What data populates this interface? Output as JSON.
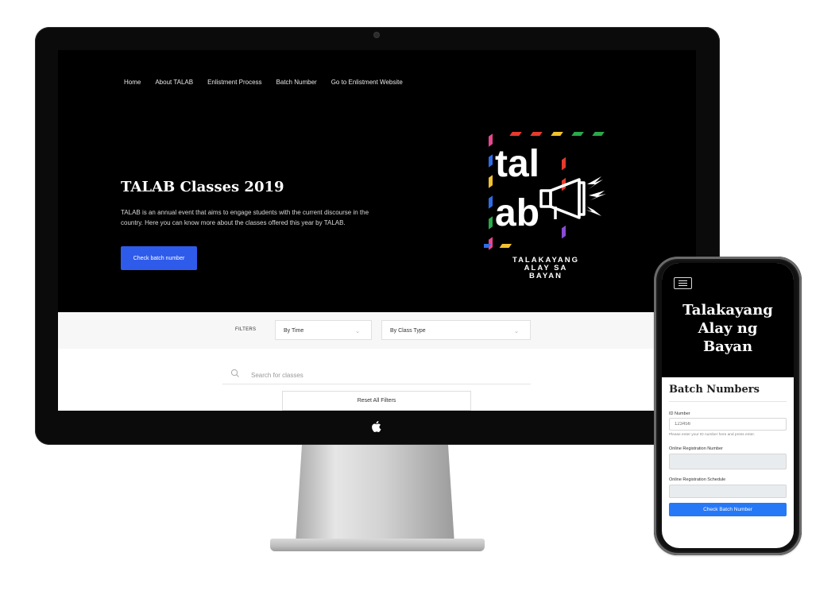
{
  "desktop": {
    "nav": [
      "Home",
      "About TALAB",
      "Enlistment Process",
      "Batch Number",
      "Go to Enlistment Website"
    ],
    "hero": {
      "title": "TALAB Classes 2019",
      "description": "TALAB is an annual event that aims to engage students with the current discourse in the country. Here you can know more about the classes offered this year by TALAB.",
      "button": "Check batch number"
    },
    "logo": {
      "line1": "tal",
      "line2": "ab",
      "tagline1": "TALAKAYANG",
      "tagline2": "ALAY SA",
      "tagline3": "BAYAN"
    },
    "filters": {
      "label": "FILTERS",
      "time_select": "By Time",
      "class_type_select": "By Class Type"
    },
    "search": {
      "placeholder": "Search for classes"
    },
    "reset_button": "Reset All Filters"
  },
  "mobile": {
    "title_lines": [
      "Talakayang",
      "Alay ng",
      "Bayan"
    ],
    "form": {
      "heading": "Batch Numbers",
      "id_label": "ID Number",
      "id_value": "123456",
      "id_help": "Please enter your ID number here and press enter.",
      "reg_number_label": "Online Registration Number",
      "reg_schedule_label": "Online Registration Schedule",
      "submit": "Check Batch Number"
    }
  },
  "colors": {
    "primary_blue": "#2f5bea",
    "mobile_button_blue": "#2678f6",
    "logo_stripes": [
      "#e63a2e",
      "#f2c12e",
      "#2aa84a",
      "#2e6de6",
      "#e8468f",
      "#8a4bd6"
    ]
  }
}
